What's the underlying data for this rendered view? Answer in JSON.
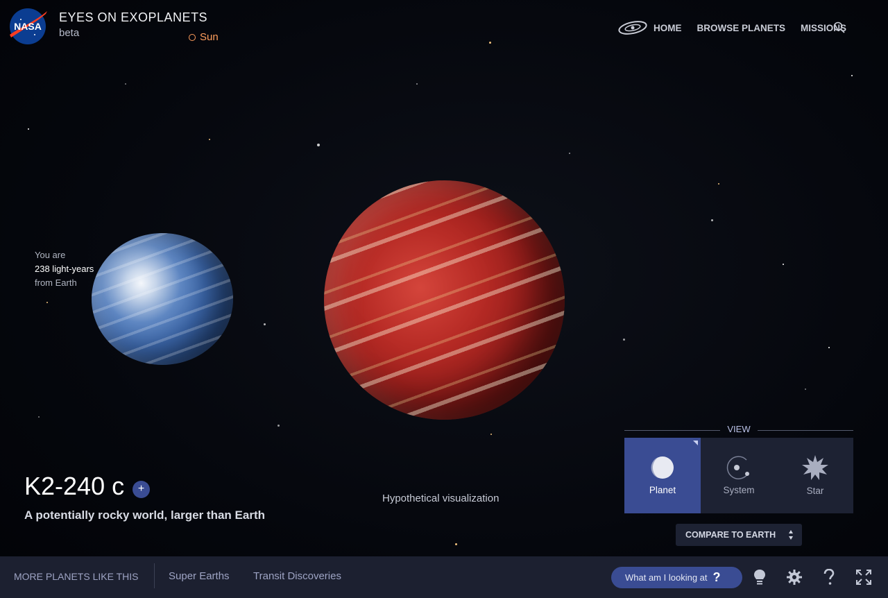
{
  "header": {
    "title": "EYES ON EXOPLANETS",
    "subtitle": "beta",
    "sun_link": "Sun",
    "nav": [
      "HOME",
      "BROWSE PLANETS",
      "MISSIONS"
    ]
  },
  "logo_text": "NASA",
  "distance": {
    "line1": "You are",
    "value": "238 light-years",
    "line3": "from Earth"
  },
  "visualization_label": "Hypothetical visualization",
  "planet": {
    "name": "K2-240 c",
    "add_symbol": "+",
    "description": "A potentially rocky world, larger than Earth"
  },
  "view": {
    "label": "VIEW",
    "options": [
      "Planet",
      "System",
      "Star"
    ],
    "selected": "Planet"
  },
  "compare_button": "COMPARE TO EARTH",
  "bottom_bar": {
    "more_label": "MORE PLANETS LIKE THIS",
    "categories": [
      "Super Earths",
      "Transit Discoveries"
    ],
    "help_button": "What am I looking at",
    "help_symbol": "?"
  },
  "colors": {
    "accent": "#3a4c93",
    "sun": "#ff9d5c",
    "panel": "#1d2233",
    "bottom_bar": "#1c2030"
  },
  "icons": [
    "galaxy-icon",
    "search-icon",
    "lightbulb-icon",
    "gear-icon",
    "question-icon",
    "fullscreen-icon"
  ]
}
